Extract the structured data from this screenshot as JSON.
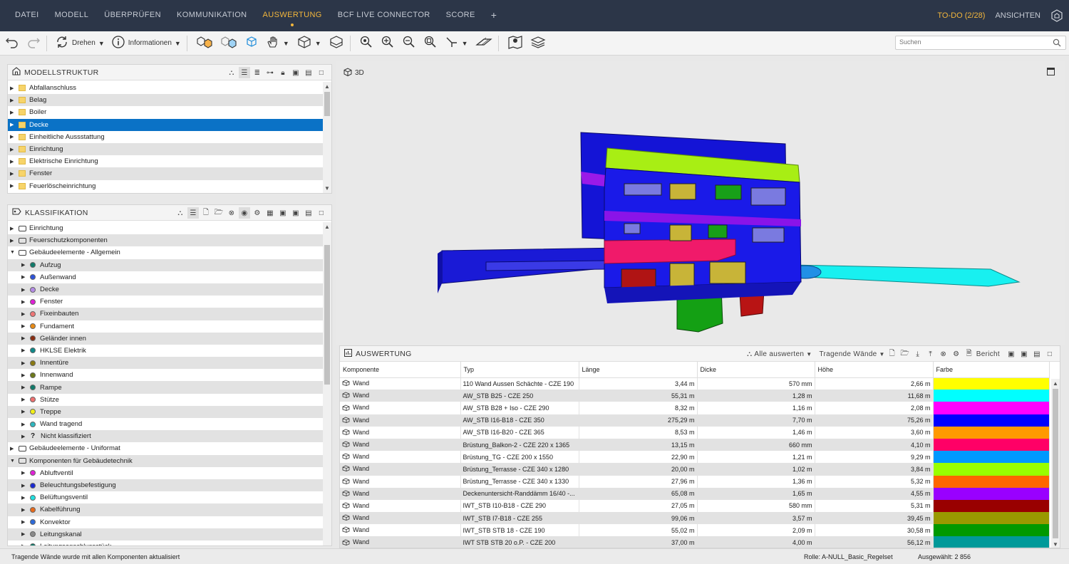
{
  "menu": {
    "tabs": [
      {
        "label": "DATEI"
      },
      {
        "label": "MODELL"
      },
      {
        "label": "ÜBERPRÜFEN"
      },
      {
        "label": "KOMMUNIKATION"
      },
      {
        "label": "AUSWERTUNG"
      },
      {
        "label": "BCF LIVE CONNECTOR"
      },
      {
        "label": "SCORE"
      }
    ],
    "add": "+",
    "todo": "TO-DO (2/28)",
    "ansichten": "ANSICHTEN",
    "active": "AUSWERTUNG"
  },
  "toolbar": {
    "drehen": "Drehen",
    "informationen": "Informationen",
    "search_placeholder": "Suchen"
  },
  "modellstruktur": {
    "title": "MODELLSTRUKTUR",
    "items": [
      {
        "label": "Abfallanschluss"
      },
      {
        "label": "Belag"
      },
      {
        "label": "Boiler"
      },
      {
        "label": "Decke",
        "selected": true
      },
      {
        "label": "Einheitliche Aussstattung"
      },
      {
        "label": "Einrichtung"
      },
      {
        "label": "Elektrische Einrichtung"
      },
      {
        "label": "Fenster"
      },
      {
        "label": "Feuerlöscheinrichtung"
      }
    ]
  },
  "klassifikation": {
    "title": "KLASSIFIKATION",
    "items": [
      {
        "label": "Einrichtung",
        "level": 0,
        "expanded": false
      },
      {
        "label": "Feuerschutzkomponenten",
        "level": 0,
        "expanded": false
      },
      {
        "label": "Gebäudeelemente - Allgemein",
        "level": 0,
        "expanded": true
      },
      {
        "label": "Aufzug",
        "level": 1,
        "color": "#0f7a6a"
      },
      {
        "label": "Außenwand",
        "level": 1,
        "color": "#2d52d9"
      },
      {
        "label": "Decke",
        "level": 1,
        "color": "#b48ae6"
      },
      {
        "label": "Fenster",
        "level": 1,
        "color": "#e020d6"
      },
      {
        "label": "Fixeinbauten",
        "level": 1,
        "color": "#ef7575"
      },
      {
        "label": "Fundament",
        "level": 1,
        "color": "#e88a14"
      },
      {
        "label": "Geländer innen",
        "level": 1,
        "color": "#8a2e12"
      },
      {
        "label": "HKLSE Elektrik",
        "level": 1,
        "color": "#0f8a8a"
      },
      {
        "label": "Innentüre",
        "level": 1,
        "color": "#8a7a12"
      },
      {
        "label": "Innenwand",
        "level": 1,
        "color": "#6e7a1a"
      },
      {
        "label": "Rampe",
        "level": 1,
        "color": "#0f7a6a"
      },
      {
        "label": "Stütze",
        "level": 1,
        "color": "#f07070"
      },
      {
        "label": "Treppe",
        "level": 1,
        "color": "#f2ef18"
      },
      {
        "label": "Wand tragend",
        "level": 1,
        "color": "#2fb7c0"
      },
      {
        "label": "Nicht klassifiziert",
        "level": 1,
        "color": "",
        "question": "?"
      },
      {
        "label": "Gebäudeelemente - Uniformat",
        "level": 0,
        "expanded": false
      },
      {
        "label": "Komponenten für Gebäudetechnik",
        "level": 0,
        "expanded": true
      },
      {
        "label": "Abluftventil",
        "level": 1,
        "color": "#e020d6"
      },
      {
        "label": "Beleuchtungsbefestigung",
        "level": 1,
        "color": "#1a2ad4"
      },
      {
        "label": "Belüftungsventil",
        "level": 1,
        "color": "#20e0e0"
      },
      {
        "label": "Kabelführung",
        "level": 1,
        "color": "#e86a1a"
      },
      {
        "label": "Konvektor",
        "level": 1,
        "color": "#2d6ad9"
      },
      {
        "label": "Leitungskanal",
        "level": 1,
        "color": "#8a8a8a"
      },
      {
        "label": "Leitungsanschlussstück",
        "level": 1,
        "color": "#0f7a6a"
      }
    ]
  },
  "viewport": {
    "title": "3D"
  },
  "auswertung": {
    "title": "AUSWERTUNG",
    "alle": "Alle auswerten",
    "tragende": "Tragende Wände",
    "bericht": "Bericht",
    "columns": [
      "Komponente",
      "Typ",
      "Länge",
      "Dicke",
      "Höhe",
      "Farbe"
    ],
    "rows": [
      {
        "komponente": "Wand",
        "typ": "110 Wand Aussen Schächte - CZE 190",
        "laenge": "3,44 m",
        "dicke": "570 mm",
        "hoehe": "2,66 m",
        "farbe": "#ffff00"
      },
      {
        "komponente": "Wand",
        "typ": "AW_STB B25 - CZE 250",
        "laenge": "55,31 m",
        "dicke": "1,28 m",
        "hoehe": "11,68 m",
        "farbe": "#00ffff"
      },
      {
        "komponente": "Wand",
        "typ": "AW_STB B28 + Iso - CZE 290",
        "laenge": "8,32 m",
        "dicke": "1,16 m",
        "hoehe": "2,08 m",
        "farbe": "#ff00ff"
      },
      {
        "komponente": "Wand",
        "typ": "AW_STB I16-B18 - CZE 350",
        "laenge": "275,29 m",
        "dicke": "7,70 m",
        "hoehe": "75,26 m",
        "farbe": "#0000ff"
      },
      {
        "komponente": "Wand",
        "typ": "AW_STB I16-B20 - CZE 365",
        "laenge": "8,53 m",
        "dicke": "1,46 m",
        "hoehe": "3,60 m",
        "farbe": "#ff9900"
      },
      {
        "komponente": "Wand",
        "typ": "Brüstung_Balkon-2 - CZE 220 x 1365",
        "laenge": "13,15 m",
        "dicke": "660 mm",
        "hoehe": "4,10 m",
        "farbe": "#ff0066"
      },
      {
        "komponente": "Wand",
        "typ": "Brüstung_TG - CZE 200 x 1550",
        "laenge": "22,90 m",
        "dicke": "1,21 m",
        "hoehe": "9,29 m",
        "farbe": "#0099ff"
      },
      {
        "komponente": "Wand",
        "typ": "Brüstung_Terrasse - CZE 340 x 1280",
        "laenge": "20,00 m",
        "dicke": "1,02 m",
        "hoehe": "3,84 m",
        "farbe": "#99ff00"
      },
      {
        "komponente": "Wand",
        "typ": "Brüstung_Terrasse - CZE 340 x 1330",
        "laenge": "27,96 m",
        "dicke": "1,36 m",
        "hoehe": "5,32 m",
        "farbe": "#ff6600"
      },
      {
        "komponente": "Wand",
        "typ": "Deckenuntersicht-Randdämm 16/40 -...",
        "laenge": "65,08 m",
        "dicke": "1,65 m",
        "hoehe": "4,55 m",
        "farbe": "#9900ff"
      },
      {
        "komponente": "Wand",
        "typ": "IWT_STB I10-B18 - CZE 290",
        "laenge": "27,05 m",
        "dicke": "580 mm",
        "hoehe": "5,31 m",
        "farbe": "#990000"
      },
      {
        "komponente": "Wand",
        "typ": "IWT_STB I7-B18 - CZE 255",
        "laenge": "99,06 m",
        "dicke": "3,57 m",
        "hoehe": "39,45 m",
        "farbe": "#999900"
      },
      {
        "komponente": "Wand",
        "typ": "IWT_STB STB 18 - CZE 190",
        "laenge": "55,02 m",
        "dicke": "2,09 m",
        "hoehe": "30,58 m",
        "farbe": "#009900"
      },
      {
        "komponente": "Wand",
        "typ": "IWT STB STB 20 o.P. - CZE 200",
        "laenge": "37,00 m",
        "dicke": "4,00 m",
        "hoehe": "56,12 m",
        "farbe": "#009999"
      }
    ]
  },
  "status": {
    "message": "Tragende Wände wurde mit allen Komponenten aktualisiert",
    "rolle": "Rolle: A-NULL_Basic_Regelset",
    "ausgewaehlt": "Ausgewählt: 2 856"
  }
}
